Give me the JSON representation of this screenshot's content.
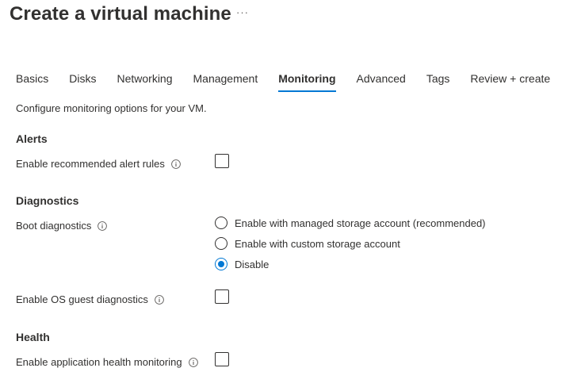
{
  "header": {
    "title": "Create a virtual machine",
    "more_label": "···"
  },
  "tabs": [
    {
      "label": "Basics",
      "active": false
    },
    {
      "label": "Disks",
      "active": false
    },
    {
      "label": "Networking",
      "active": false
    },
    {
      "label": "Management",
      "active": false
    },
    {
      "label": "Monitoring",
      "active": true
    },
    {
      "label": "Advanced",
      "active": false
    },
    {
      "label": "Tags",
      "active": false
    },
    {
      "label": "Review + create",
      "active": false
    }
  ],
  "description": "Configure monitoring options for your VM.",
  "alerts": {
    "title": "Alerts",
    "alert_rules_label": "Enable recommended alert rules",
    "alert_rules_checked": false
  },
  "diagnostics": {
    "title": "Diagnostics",
    "boot_label": "Boot diagnostics",
    "boot_options": [
      {
        "label": "Enable with managed storage account (recommended)",
        "selected": false
      },
      {
        "label": "Enable with custom storage account",
        "selected": false
      },
      {
        "label": "Disable",
        "selected": true
      }
    ],
    "os_guest_label": "Enable OS guest diagnostics",
    "os_guest_checked": false
  },
  "health": {
    "title": "Health",
    "app_health_label": "Enable application health monitoring",
    "app_health_checked": false
  },
  "colors": {
    "accent": "#0078d4",
    "text": "#323130",
    "muted": "#605e5c"
  },
  "icons": {
    "info": "info-icon",
    "more": "more-icon"
  }
}
